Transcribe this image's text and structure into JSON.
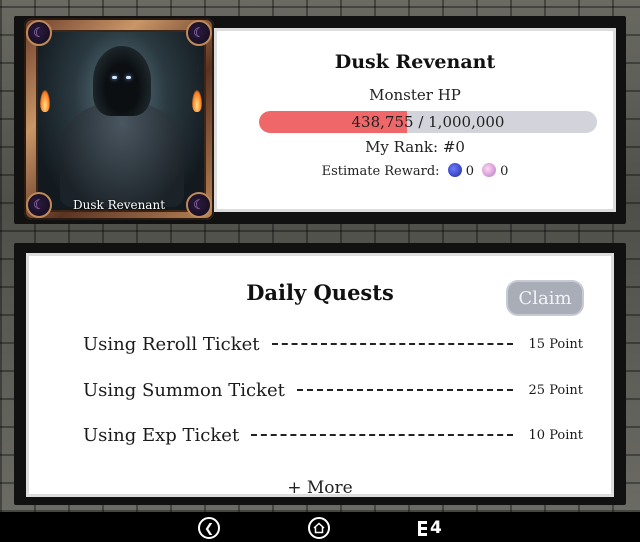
{
  "boss": {
    "name": "Dusk Revenant",
    "hp_label": "Monster HP",
    "hp_current": "438,755",
    "hp_max": "1,000,000",
    "hp_text": "438,755 / 1,000,000",
    "hp_fraction": 0.4388,
    "rank_text": "My Rank: #0",
    "reward_label": "Estimate Reward:",
    "reward_coin_1": "0",
    "reward_coin_2": "0",
    "card_name": "Dusk Revenant"
  },
  "quests": {
    "title": "Daily Quests",
    "claim_label": "Claim",
    "items": [
      {
        "label": "Using Reroll Ticket",
        "points": "15 Point"
      },
      {
        "label": "Using Summon Ticket",
        "points": "25 Point"
      },
      {
        "label": "Using Exp Ticket",
        "points": "10 Point"
      }
    ],
    "more_label": "+ More"
  },
  "nav": {
    "back_icon": "chevron-left-icon",
    "home_icon": "home-icon",
    "menu_icon": "menu-list-icon",
    "menu_count": "4"
  },
  "colors": {
    "hp_fill": "#f0676a",
    "hp_track": "#d3d4db",
    "claim_bg": "#a9adb8"
  }
}
